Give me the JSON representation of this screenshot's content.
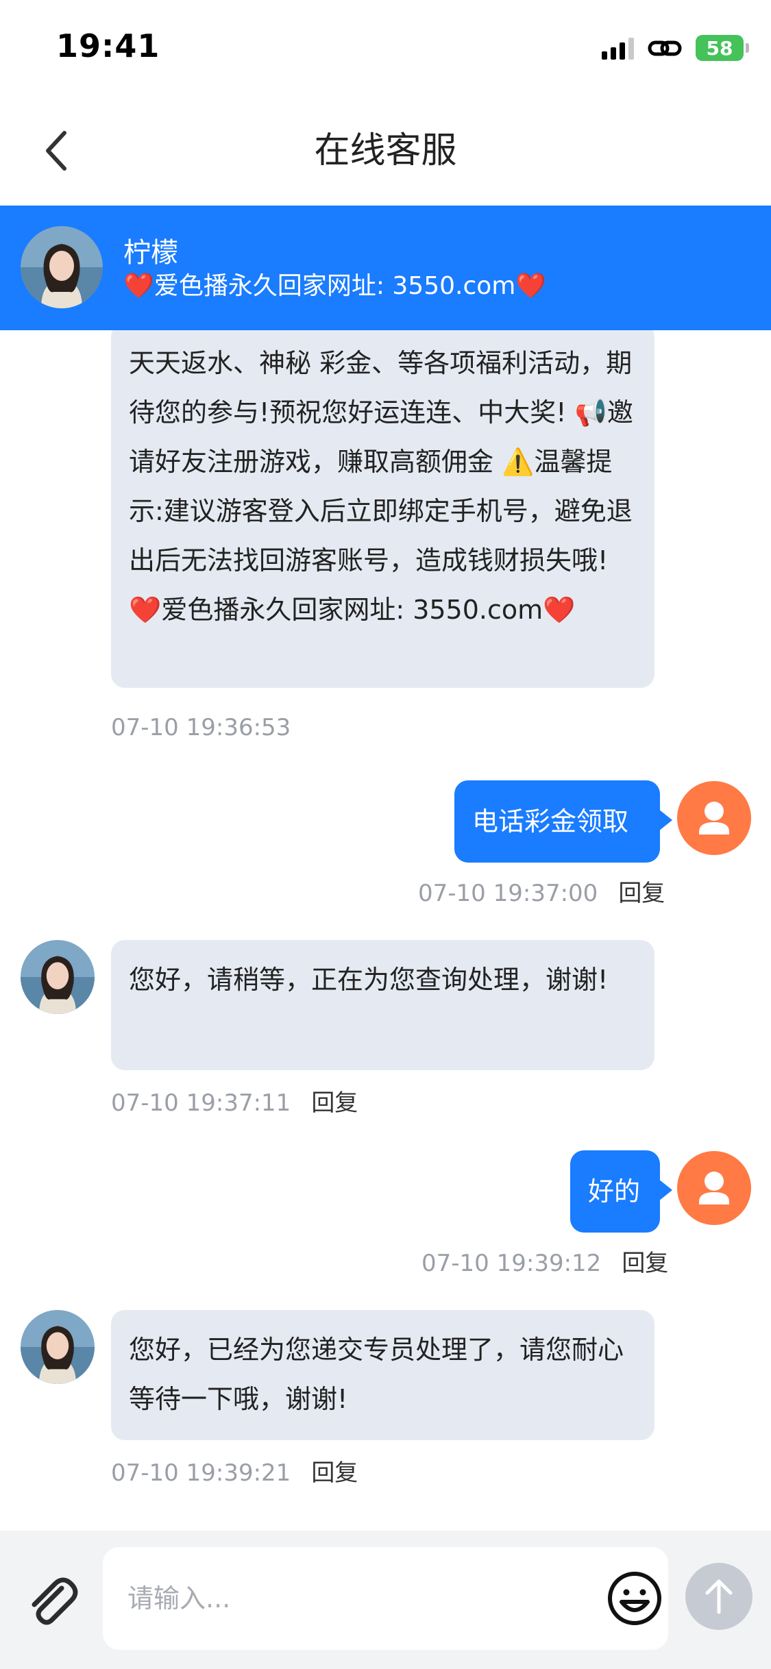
{
  "status_bar": {
    "time": "19:41",
    "battery": "58"
  },
  "nav": {
    "title": "在线客服"
  },
  "agent": {
    "name": "柠檬",
    "subtitle": "❤️爱色播永久回家网址: 3550.com❤️"
  },
  "messages": [
    {
      "sender": "agent",
      "text": "天天返水、神秘 彩金、等各项福利活动，期待您的参与!预祝您好运连连、中大奖! 📢邀请好友注册游戏，赚取高额佣金 ⚠️温馨提示:建议游客登入后立即绑定手机号，避免退出后无法找回游客账号，造成钱财损失哦! ❤️爱色播永久回家网址: 3550.com❤️",
      "time": "07-10 19:36:53"
    },
    {
      "sender": "user",
      "text": "电话彩金领取",
      "time": "07-10 19:37:00",
      "reply": "回复"
    },
    {
      "sender": "agent",
      "text": "您好，请稍等，正在为您查询处理，谢谢!",
      "time": "07-10 19:37:11",
      "reply": "回复"
    },
    {
      "sender": "user",
      "text": "好的",
      "time": "07-10 19:39:12",
      "reply": "回复"
    },
    {
      "sender": "agent",
      "text": "您好，已经为您递交专员处理了，请您耐心等待一下哦，谢谢!",
      "time": "07-10 19:39:21",
      "reply": "回复"
    }
  ],
  "input": {
    "placeholder": "请输入..."
  },
  "icons": {
    "back": "chevron-left-icon",
    "signal": "signal-icon",
    "link": "link-icon",
    "battery": "battery-icon",
    "attach": "paperclip-icon",
    "emoji": "smiley-icon",
    "send": "arrow-up-icon",
    "user_avatar": "person-icon"
  },
  "colors": {
    "primary": "#1a7cff",
    "agent_bubble": "#e5eaf2",
    "user_avatar": "#ff7a45",
    "send_disabled": "#c6cbd3",
    "battery": "#45c25a"
  }
}
